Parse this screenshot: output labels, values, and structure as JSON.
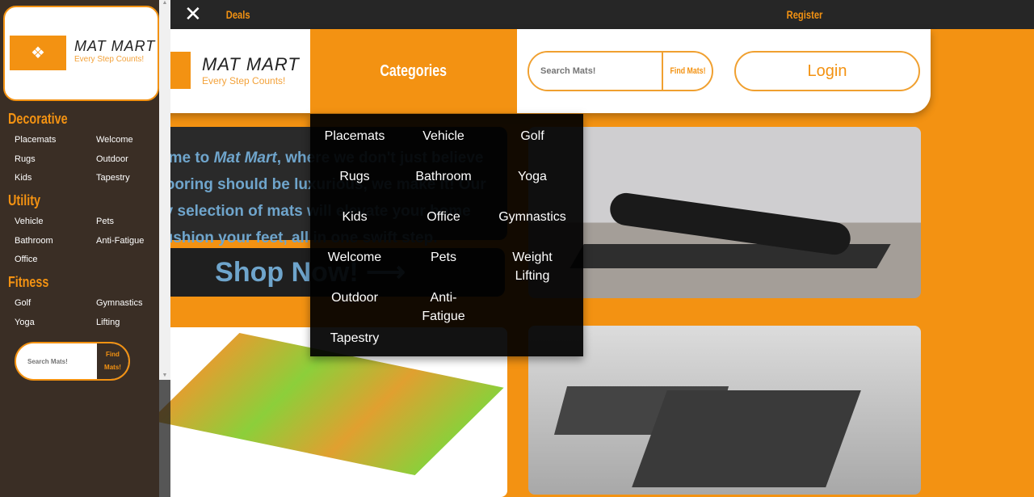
{
  "topbar": {
    "close": "✕",
    "deals": "Deals",
    "register": "Register"
  },
  "brand": {
    "name": "MAT MART",
    "tagline": "Every Step Counts!",
    "icon": "❖"
  },
  "header": {
    "categories": "Categories",
    "search_placeholder": "Search Mats!",
    "search_button": "Find Mats!",
    "login": "Login"
  },
  "hero": {
    "pre": "Welcome to",
    "brand": "Mat Mart",
    "text": ", where we don't just believe that flooring should be luxurious, we make it! Our quality selection of mats will elevate your home and cushion your feet, all in one swift step.",
    "shop": "Shop Now! ⟶"
  },
  "menu": [
    "Placemats",
    "Vehicle",
    "Golf",
    "Rugs",
    "Bathroom",
    "Yoga",
    "Kids",
    "Office",
    "Gymnastics",
    "Welcome",
    "Pets",
    "Weight Lifting",
    "Outdoor",
    "Anti-Fatigue",
    "",
    "Tapestry"
  ],
  "sidebar": {
    "sections": [
      {
        "title": "Decorative",
        "items": [
          "Placemats",
          "Welcome",
          "Rugs",
          "Outdoor",
          "Kids",
          "Tapestry"
        ]
      },
      {
        "title": "Utility",
        "items": [
          "Vehicle",
          "Pets",
          "Bathroom",
          "Anti-Fatigue",
          "Office"
        ]
      },
      {
        "title": "Fitness",
        "items": [
          "Golf",
          "Gymnastics",
          "Yoga",
          "Lifting"
        ]
      }
    ],
    "search_placeholder": "Search Mats!",
    "search_button": "Find Mats!"
  },
  "colors": {
    "accent": "#f39212",
    "dark": "#262626",
    "sidebar": "#3a2e25",
    "hero_text": "#6fa5cc"
  }
}
